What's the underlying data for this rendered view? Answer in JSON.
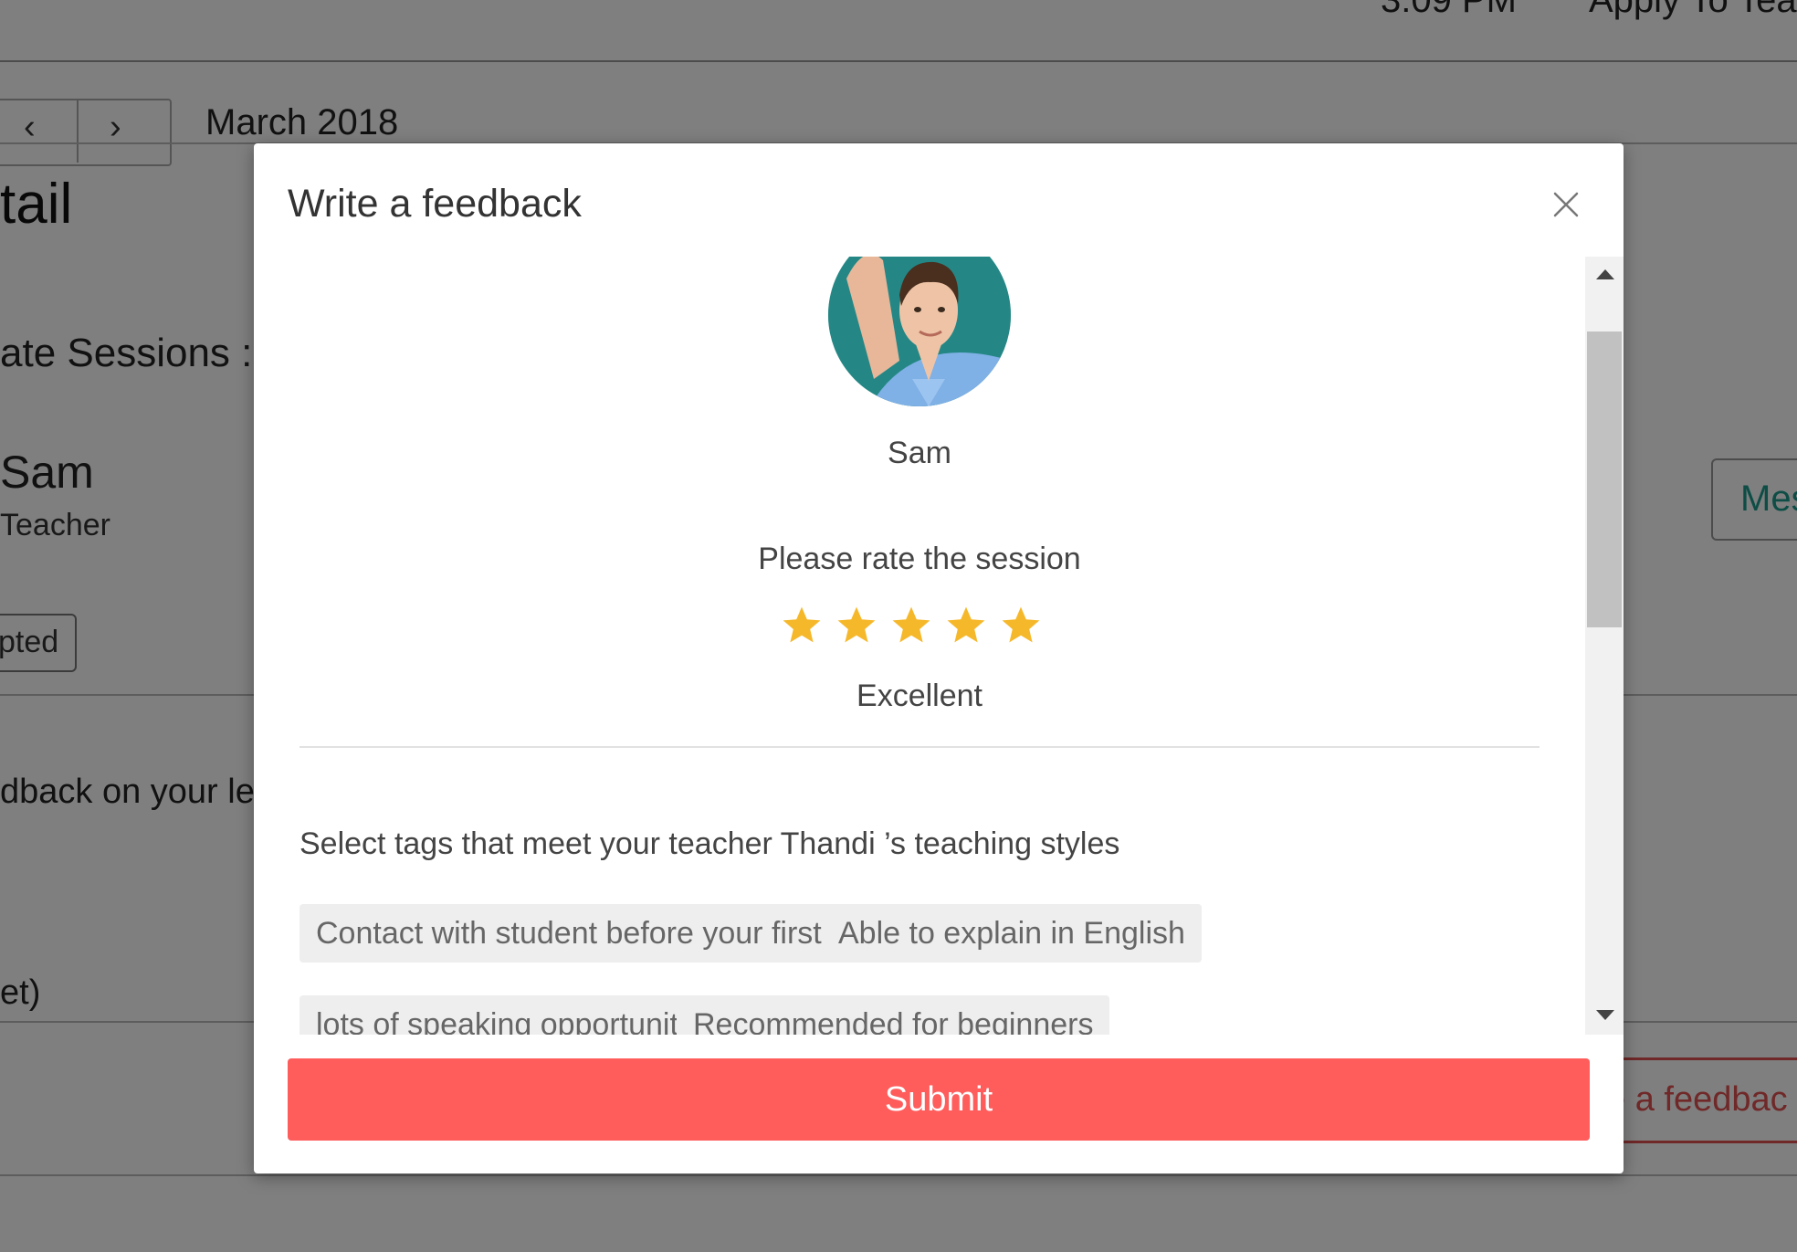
{
  "background": {
    "time": "3:09 PM",
    "apply_link": "Apply To Tea",
    "month": "March 2018",
    "page_title": "tail",
    "sessions_label": "ate Sessions :",
    "teacher_name": "Sam",
    "teacher_role": "Teacher",
    "status_tag": "pted",
    "feedback_prompt": "dback on your le",
    "note_text": "et)",
    "message_button": "Mes",
    "write_feedback_button": "e a feedbac"
  },
  "modal": {
    "title": "Write a feedback",
    "teacher_name": "Sam",
    "rate_label": "Please rate the session",
    "rating": 5,
    "rating_max": 5,
    "rating_word": "Excellent",
    "tags_prompt": "Select tags that meet your teacher Thandi ’s teaching styles",
    "tags": [
      "Contact with student before your first class",
      "Able to explain in English",
      "lots of speaking opportunities",
      "Recommended for beginners"
    ],
    "submit_label": "Submit"
  },
  "colors": {
    "submit": "#ff5c5c",
    "star": "#f6b82b",
    "tag_bg": "#eeeeee",
    "overlay": "rgba(0,0,0,0.5)"
  },
  "icons": {
    "close": "close-icon",
    "star": "star-icon",
    "prev": "chevron-left-icon",
    "next": "chevron-right-icon",
    "scroll_up": "scroll-up-arrow-icon",
    "scroll_down": "scroll-down-arrow-icon"
  }
}
